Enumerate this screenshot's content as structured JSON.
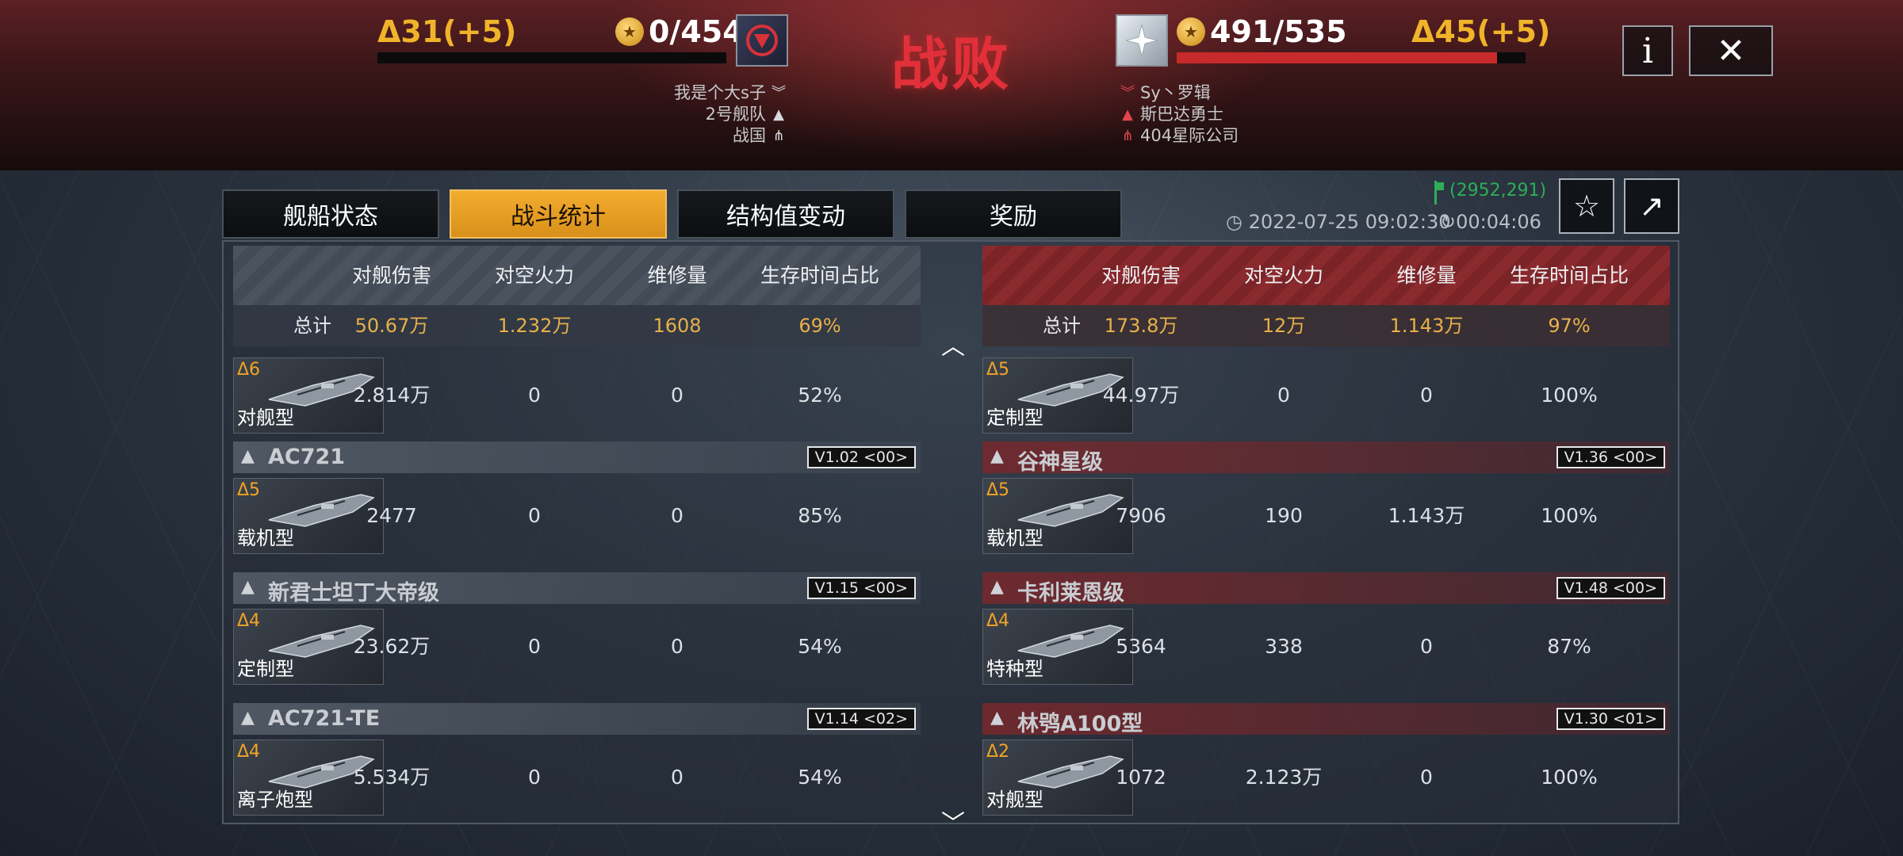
{
  "header": {
    "title": "战败",
    "left": {
      "delta": "Δ31(+5)",
      "score": "0/454",
      "hp_fraction": 0.0
    },
    "right": {
      "delta": "Δ45(+5)",
      "score": "491/535",
      "hp_fraction": 0.918
    },
    "left_players": [
      {
        "name": "我是个大s子",
        "icon": "rank-chevron-icon"
      },
      {
        "name": "2号舰队",
        "icon": "fleet-arrow-icon"
      },
      {
        "name": "战国",
        "icon": "guild-icon"
      }
    ],
    "right_players": [
      {
        "name": "Sy丶罗辑",
        "icon": "rank-chevron-icon"
      },
      {
        "name": "斯巴达勇士",
        "icon": "fleet-arrow-icon"
      },
      {
        "name": "404星际公司",
        "icon": "guild-icon"
      }
    ],
    "info_label": "i",
    "close_label": "✕"
  },
  "tabs": [
    {
      "label": "舰船状态",
      "active": false
    },
    {
      "label": "战斗统计",
      "active": true
    },
    {
      "label": "结构值变动",
      "active": false
    },
    {
      "label": "奖励",
      "active": false
    }
  ],
  "meta": {
    "coords": "(2952,291)",
    "date": "2022-07-25 09:02:30",
    "duration": "00:04:06"
  },
  "columns": [
    "对舰伤害",
    "对空火力",
    "维修量",
    "生存时间占比"
  ],
  "left": {
    "totals": {
      "label": "总计",
      "values": [
        "50.67万",
        "1.232万",
        "1608",
        "69%"
      ]
    },
    "first_ship": {
      "level": "Δ6",
      "type": "对舰型",
      "values": [
        "2.814万",
        "0",
        "0",
        "52%"
      ]
    },
    "groups": [
      {
        "class_name": "AC721",
        "version": "V1.02 <00>",
        "level": "Δ5",
        "type": "载机型",
        "values": [
          "2477",
          "0",
          "0",
          "85%"
        ]
      },
      {
        "class_name": "新君士坦丁大帝级",
        "version": "V1.15 <00>",
        "level": "Δ4",
        "type": "定制型",
        "values": [
          "23.62万",
          "0",
          "0",
          "54%"
        ]
      },
      {
        "class_name": "AC721-TE",
        "version": "V1.14 <02>",
        "level": "Δ4",
        "type": "离子炮型",
        "values": [
          "5.534万",
          "0",
          "0",
          "54%"
        ]
      }
    ]
  },
  "right": {
    "totals": {
      "label": "总计",
      "values": [
        "173.8万",
        "12万",
        "1.143万",
        "97%"
      ]
    },
    "first_ship": {
      "level": "Δ5",
      "type": "定制型",
      "values": [
        "44.97万",
        "0",
        "0",
        "100%"
      ]
    },
    "groups": [
      {
        "class_name": "谷神星级",
        "version": "V1.36 <00>",
        "level": "Δ5",
        "type": "载机型",
        "values": [
          "7906",
          "190",
          "1.143万",
          "100%"
        ]
      },
      {
        "class_name": "卡利莱恩级",
        "version": "V1.48 <00>",
        "level": "Δ4",
        "type": "特种型",
        "values": [
          "5364",
          "338",
          "0",
          "87%"
        ]
      },
      {
        "class_name": "林鸮A100型",
        "version": "V1.30 <01>",
        "level": "Δ2",
        "type": "对舰型",
        "values": [
          "1072",
          "2.123万",
          "0",
          "100%"
        ]
      }
    ]
  }
}
